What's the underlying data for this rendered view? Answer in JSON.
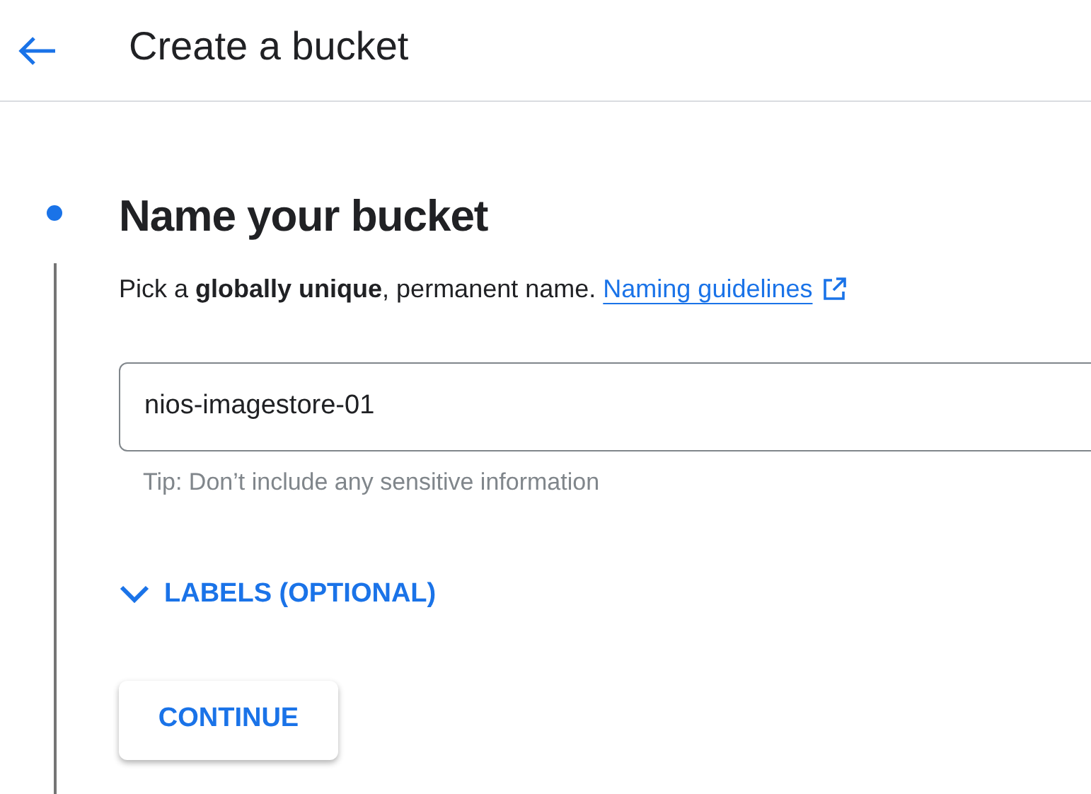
{
  "header": {
    "title": "Create a bucket"
  },
  "step": {
    "title": "Name your bucket",
    "description": "Pick a **globally unique**, permanent name.",
    "link": "Naming guidelines",
    "name_field": {
      "value": "nios-imagestore-01",
      "hint": "Tip: Don’t include any sensitive information"
    },
    "labels_toggle": {
      "label": "LABELS (OPTIONAL)",
      "expanded": false
    },
    "continue_button": "CONTINUE"
  }
}
